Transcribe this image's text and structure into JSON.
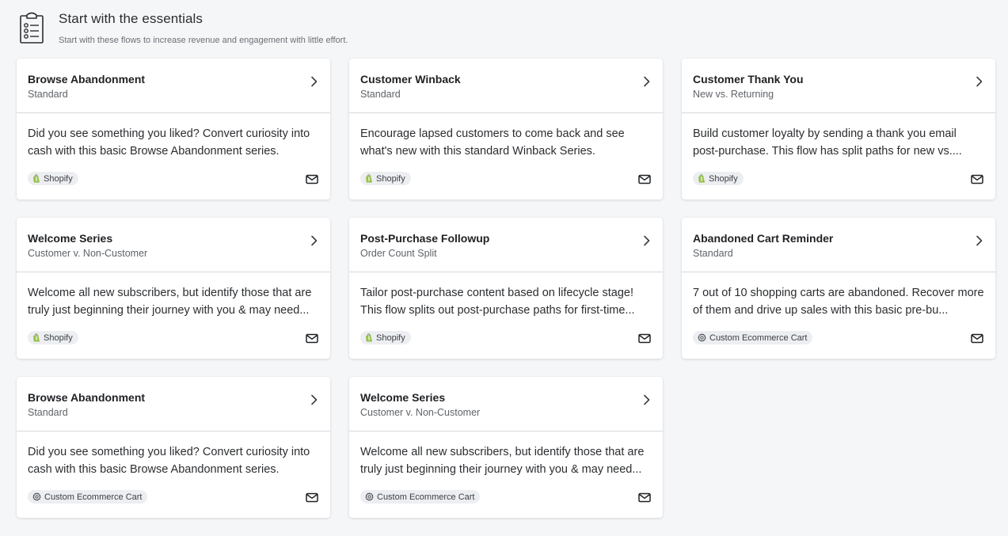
{
  "header": {
    "icon": "clipboard-list-icon",
    "title": "Start with the essentials",
    "subtitle": "Start with these flows to increase revenue and engagement with little effort."
  },
  "cards": [
    {
      "title": "Browse Abandonment",
      "subtitle": "Standard",
      "description": "Did you see something you liked? Convert curiosity into cash with this basic Browse Abandonment series.",
      "integration": "Shopify",
      "integration_icon": "shopify-icon",
      "channel_icon": "mail-icon"
    },
    {
      "title": "Customer Winback",
      "subtitle": "Standard",
      "description": "Encourage lapsed customers to come back and see what's new with this standard Winback Series.",
      "integration": "Shopify",
      "integration_icon": "shopify-icon",
      "channel_icon": "mail-icon"
    },
    {
      "title": "Customer Thank You",
      "subtitle": "New vs. Returning",
      "description": "Build customer loyalty by sending a thank you email post-purchase. This flow has split paths for new vs....",
      "integration": "Shopify",
      "integration_icon": "shopify-icon",
      "channel_icon": "mail-icon"
    },
    {
      "title": "Welcome Series",
      "subtitle": "Customer v. Non-Customer",
      "description": "Welcome all new subscribers, but identify those that are truly just beginning their journey with you & may need...",
      "integration": "Shopify",
      "integration_icon": "shopify-icon",
      "channel_icon": "mail-icon"
    },
    {
      "title": "Post-Purchase Followup",
      "subtitle": "Order Count Split",
      "description": "Tailor post-purchase content based on lifecycle stage! This flow splits out post-purchase paths for first-time...",
      "integration": "Shopify",
      "integration_icon": "shopify-icon",
      "channel_icon": "mail-icon"
    },
    {
      "title": "Abandoned Cart Reminder",
      "subtitle": "Standard",
      "description": "7 out of 10 shopping carts are abandoned. Recover more of them and drive up sales with this basic pre-bu...",
      "integration": "Custom Ecommerce Cart",
      "integration_icon": "gear-icon",
      "channel_icon": "mail-icon"
    },
    {
      "title": "Browse Abandonment",
      "subtitle": "Standard",
      "description": "Did you see something you liked? Convert curiosity into cash with this basic Browse Abandonment series.",
      "integration": "Custom Ecommerce Cart",
      "integration_icon": "gear-icon",
      "channel_icon": "mail-icon"
    },
    {
      "title": "Welcome Series",
      "subtitle": "Customer v. Non-Customer",
      "description": "Welcome all new subscribers, but identify those that are truly just beginning their journey with you & may need...",
      "integration": "Custom Ecommerce Cart",
      "integration_icon": "gear-icon",
      "channel_icon": "mail-icon"
    }
  ],
  "colors": {
    "background": "#f5f6f8",
    "card": "#ffffff",
    "badge": "#eceef1",
    "shopify_green": "#95bf47"
  }
}
